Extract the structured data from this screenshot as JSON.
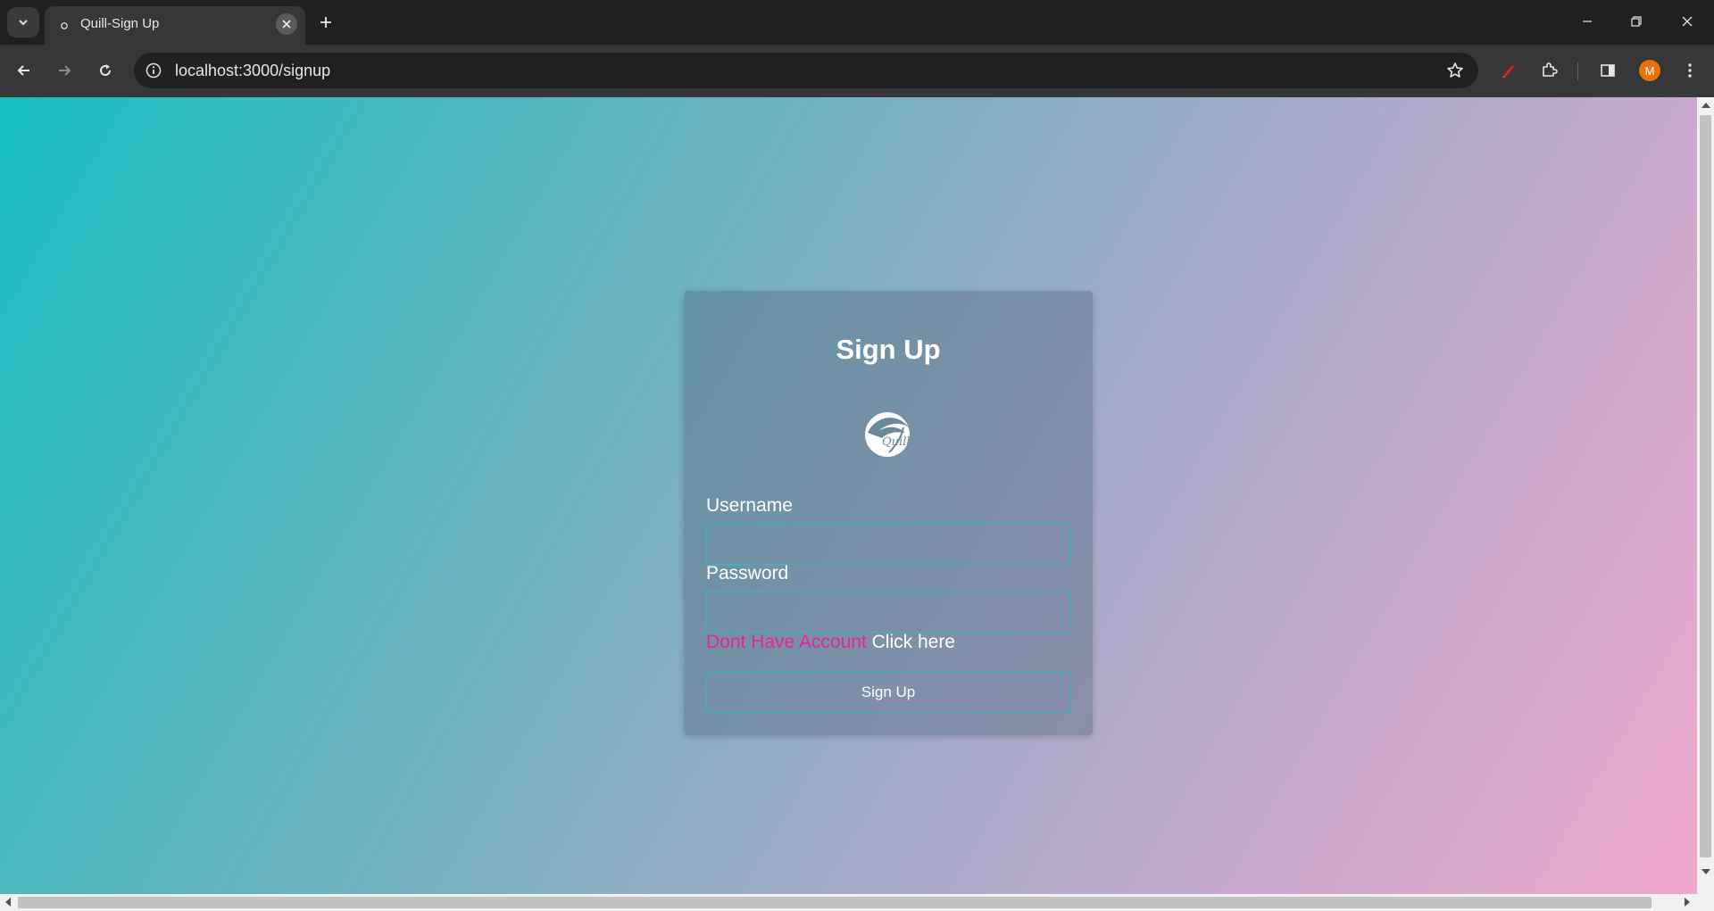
{
  "browser": {
    "tab_title": "Quill-Sign Up",
    "url": "localhost:3000/signup",
    "profile_initial": "M"
  },
  "form": {
    "title": "Sign Up",
    "logo_text": "Quill",
    "username_label": "Username",
    "username_value": "",
    "password_label": "Password",
    "password_value": "",
    "no_account_text": "Dont Have Account",
    "click_here_text": "Click here",
    "submit_label": "Sign Up"
  },
  "colors": {
    "gradient_start": "#16c0c2",
    "gradient_end": "#f0a7cf",
    "accent_border": "#30b8bc",
    "link_pink": "#e8239a",
    "avatar": "#e8710a"
  }
}
